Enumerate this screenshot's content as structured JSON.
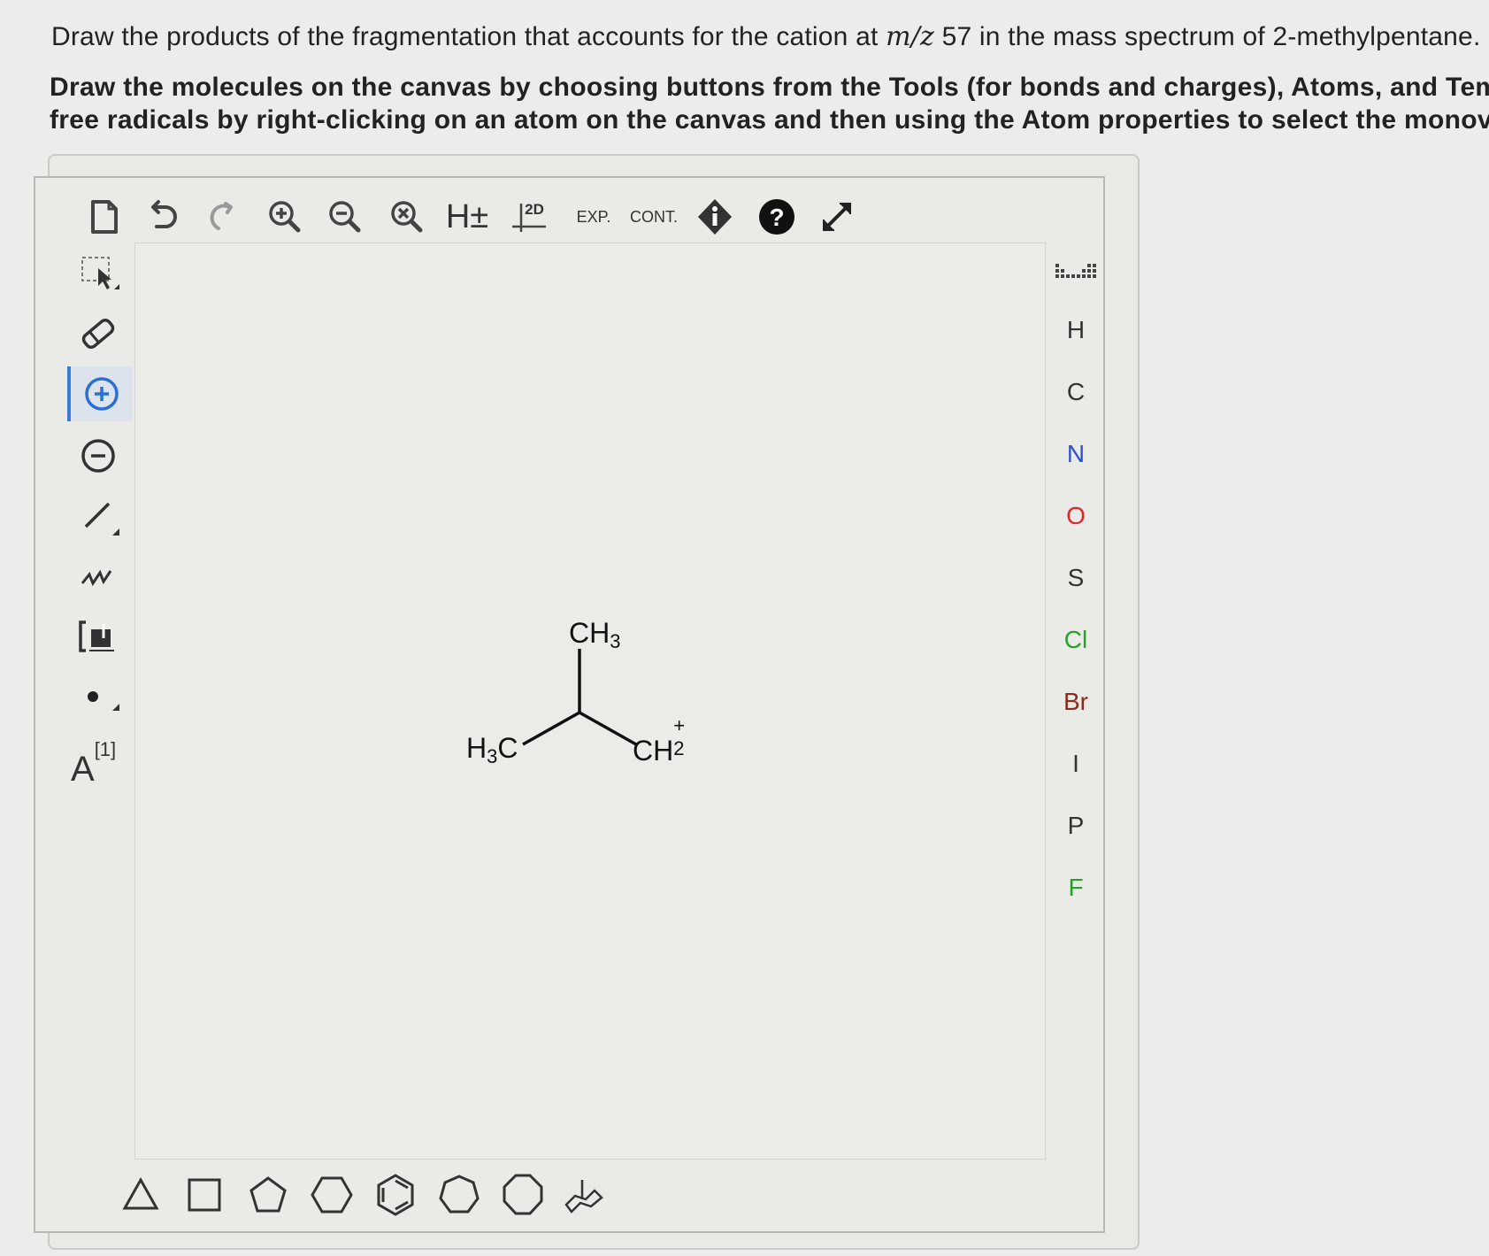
{
  "question": {
    "line1_pre": "Draw the products of the fragmentation that accounts for the cation at ",
    "line1_math": "m/z",
    "line1_post": " 57 in the mass spectrum of 2-methylpentane.",
    "line2": "Draw the molecules on the canvas by choosing buttons from the Tools (for bonds and charges), Atoms, and Temp",
    "line3": "free radicals by right-clicking on an atom on the canvas and then using the Atom properties to select the monoval"
  },
  "toolbar": {
    "h_toggle": "H±",
    "clean2d": "2D",
    "expand": "EXP.",
    "contract": "CONT."
  },
  "left_tools": {
    "atom_label_tool": "A",
    "atom_label_index": "[1]"
  },
  "atoms": [
    "H",
    "C",
    "N",
    "O",
    "S",
    "Cl",
    "Br",
    "I",
    "P",
    "F"
  ],
  "atom_colors": {
    "H": "#333333",
    "C": "#333333",
    "N": "#2c4fd6",
    "O": "#e0262b",
    "S": "#333333",
    "Cl": "#2aa02a",
    "Br": "#8a2b1e",
    "I": "#333333",
    "P": "#333333",
    "F": "#2aa02a"
  },
  "molecule": {
    "top_label": "CH",
    "top_sub": "3",
    "left_label": "H",
    "left_sub": "3",
    "left_label_tail": "C",
    "right_label": "CH",
    "right_sub": "2",
    "right_sup": "+"
  },
  "templates": [
    "triangle",
    "square",
    "pentagon",
    "hexagon",
    "benzene",
    "heptagon",
    "octagon",
    "cyclohexane-chair"
  ]
}
